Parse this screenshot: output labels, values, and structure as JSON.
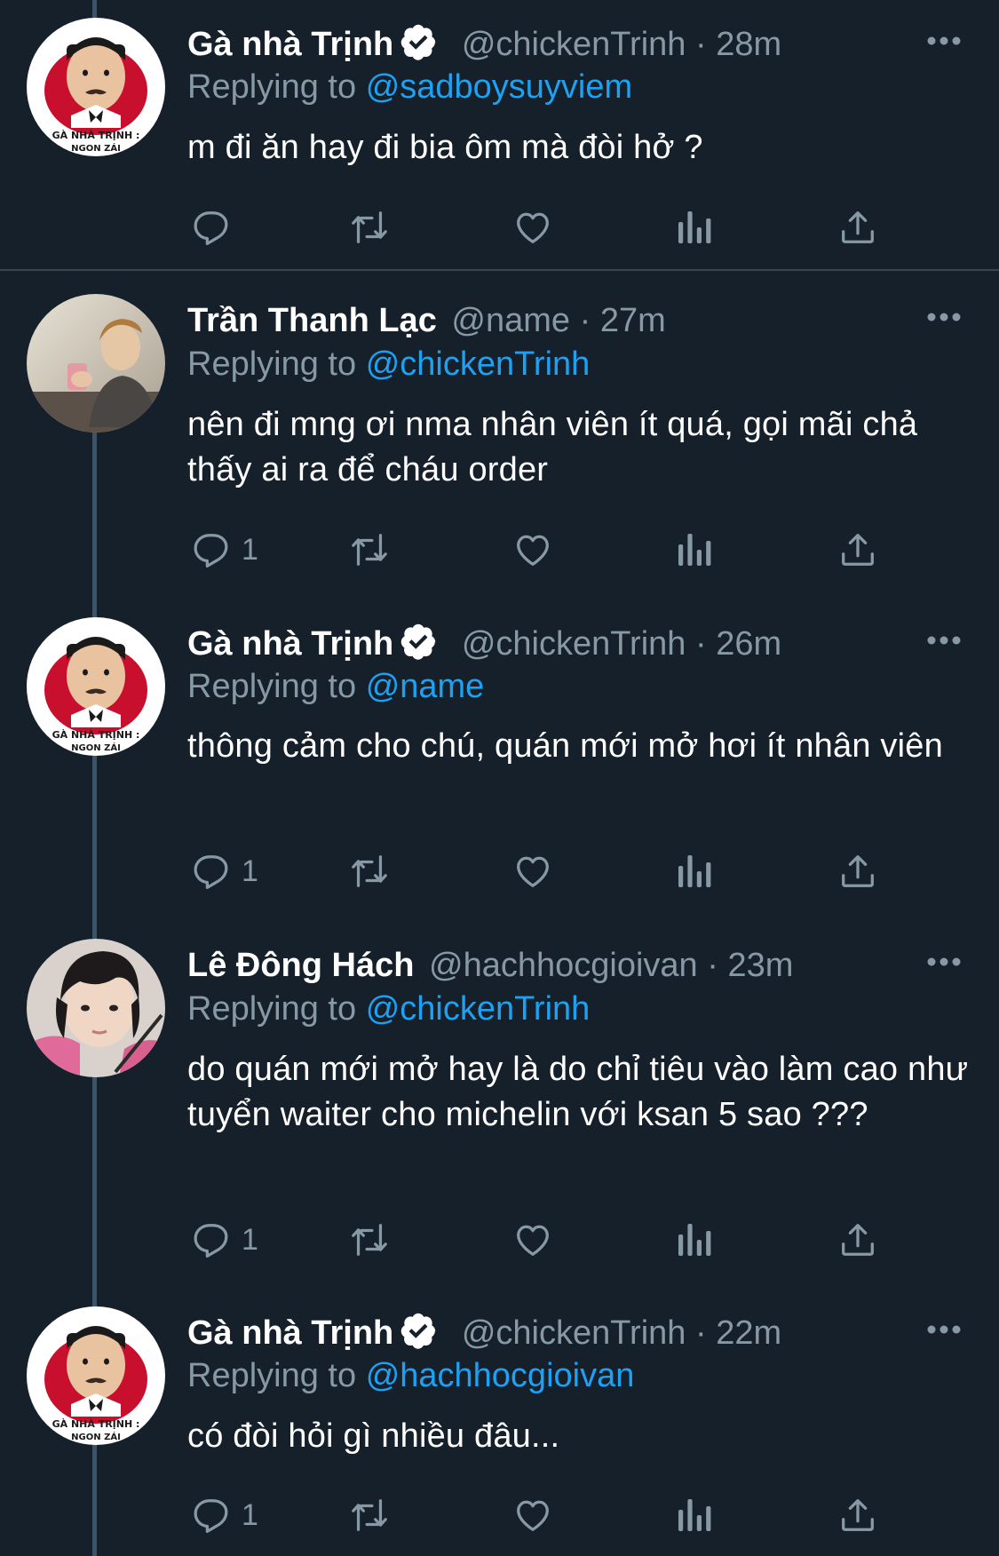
{
  "reply_prefix": "Replying to",
  "tweets": [
    {
      "name": "Gà nhà Trịnh",
      "verified": true,
      "avatar": "chicken-logo",
      "handle": "@chickenTrinh",
      "dot": "·",
      "time": "28m",
      "replying_to": "@sadboysuyviem",
      "text": "m đi ăn hay đi bia ôm mà đòi hở ?",
      "reply_count": ""
    },
    {
      "name": "Trần Thanh Lạc",
      "verified": false,
      "avatar": "photo",
      "handle": "@name",
      "dot": "·",
      "time": "27m",
      "replying_to": "@chickenTrinh",
      "text": "nên đi mng ơi nma nhân viên ít quá, gọi mãi chả thấy ai ra để cháu order",
      "reply_count": "1"
    },
    {
      "name": "Gà nhà Trịnh",
      "verified": true,
      "avatar": "chicken-logo",
      "handle": "@chickenTrinh",
      "dot": "·",
      "time": "26m",
      "replying_to": "@name",
      "text": "thông cảm cho chú, quán mới mở hơi ít nhân viên",
      "reply_count": "1"
    },
    {
      "name": "Lê Đông Hách",
      "verified": false,
      "avatar": "photo",
      "handle": "@hachhocgioivan",
      "dot": "·",
      "time": "23m",
      "replying_to": "@chickenTrinh",
      "text": "do quán mới mở hay là do chỉ tiêu vào làm cao như tuyển waiter cho michelin với ksan 5 sao ???",
      "reply_count": "1"
    },
    {
      "name": "Gà nhà Trịnh",
      "verified": true,
      "avatar": "chicken-logo",
      "handle": "@chickenTrinh",
      "dot": "·",
      "time": "22m",
      "replying_to": "@hachhocgioivan",
      "text": "có đòi hỏi gì nhiều đâu...",
      "reply_count": "1"
    }
  ],
  "icons": {
    "reply": "reply-icon",
    "retweet": "retweet-icon",
    "like": "heart-icon",
    "analytics": "analytics-icon",
    "share": "share-icon",
    "more": "more-icon",
    "verified": "verified-badge-icon"
  },
  "colors": {
    "background": "#15202b",
    "text": "#ffffff",
    "secondary": "#8899a6",
    "accent": "#1da1f2",
    "divider": "#38444d",
    "thread_line": "#3d5466"
  }
}
